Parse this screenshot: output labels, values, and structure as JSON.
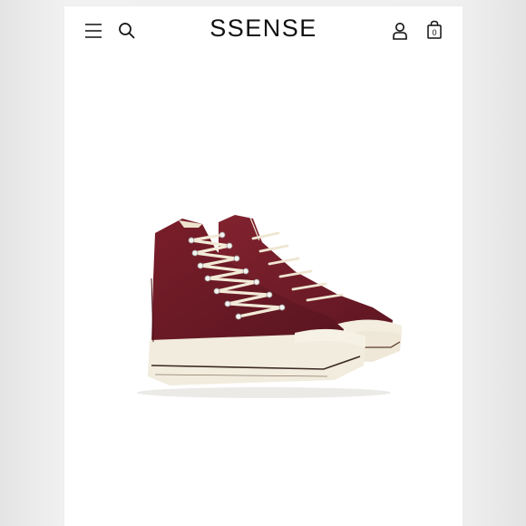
{
  "header": {
    "logo": "SSENSE",
    "bag_count": "0"
  },
  "icons": {
    "menu": "hamburger-menu-icon",
    "search": "search-icon",
    "account": "user-icon",
    "bag": "shopping-bag-icon"
  },
  "product": {
    "image": "burgundy-high-top-sneakers"
  },
  "colors": {
    "shoe_canvas": "#6e1a24",
    "shoe_sole": "#f1eadb",
    "background": "#ffffff"
  }
}
